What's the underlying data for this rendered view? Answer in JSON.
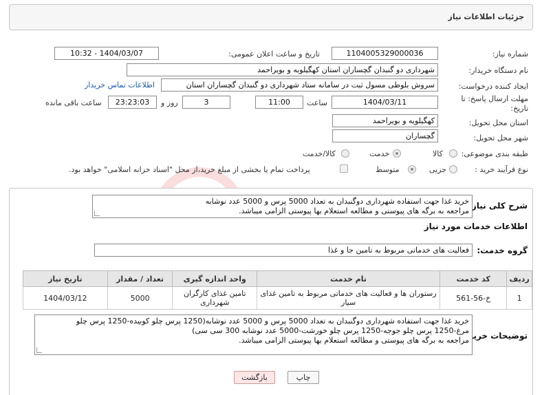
{
  "header": {
    "title": "جزئیات اطلاعات نیاز"
  },
  "form": {
    "need_number_label": "شماره نیاز:",
    "need_number": "1104005329000036",
    "announce_label": "تاریخ و ساعت اعلان عمومی:",
    "announce_value": "1404/03/07 - 10:32",
    "buyer_org_label": "نام دستگاه خریدار:",
    "buyer_org": "شهرداری دو گنبدان گچساران استان کهگیلویه و بویراحمد",
    "creator_label": "ایجاد کننده درخواست:",
    "creator": "سروش بلوطی مسول ثبت در سامانه ستاد شهرداری دو گنبدان گچساران استان",
    "contact_link": "اطلاعات تماس خریدار",
    "deadline_label_1": "مهلت ارسال پاسخ: تا",
    "deadline_label_2": "تاریخ:",
    "deadline_date": "1404/03/11",
    "time_label": "ساعت",
    "deadline_time": "11:00",
    "days": "3",
    "days_label": "روز و",
    "remaining": "23:23:03",
    "remaining_label": "ساعت باقی مانده",
    "province_label": "استان محل تحویل:",
    "province": "کهگیلویه و بویراحمد",
    "city_label": "شهر محل تحویل:",
    "city": "گچساران",
    "category_label": "طبقه بندی موضوعی:",
    "category_options": [
      "کالا",
      "خدمت",
      "کالا/خدمت"
    ],
    "category_selected": "خدمت",
    "process_label": "نوع فرآیند خرید :",
    "process_options": [
      "جزیی",
      "متوسط"
    ],
    "process_selected": "متوسط",
    "payment_note": "پرداخت تمام یا بخشی از مبلغ خرید،از محل \"اسناد خزانه اسلامی\" خواهد بود."
  },
  "description": {
    "label": "شرح کلی نیاز:",
    "line1": "خرید غذا جهت استفاده شهرداری دوگنبدان به تعداد 5000 پرس و 5000 عدد نوشابه",
    "line2": "مراجعه به برگه های پیوستی و مطالعه استعلام بها پیوستی الزامی میباشد."
  },
  "services": {
    "heading": "اطلاعات خدمات مورد نیاز",
    "group_label": "گروه خدمت:",
    "group_value": "فعالیت های خدماتی مربوط به تامین جا و غذا",
    "table_headers": [
      "ردیف",
      "کد خدمت",
      "نام خدمت",
      "واحد اندازه گیری",
      "تعداد / مقدار",
      "تاریخ نیاز"
    ],
    "rows": [
      {
        "row": "1",
        "code": "خ-56-561",
        "name": "رستوران ها و فعالیت های خدماتی مربوط به تامین غذای سیار",
        "unit_1": "تامین غذای کارگران",
        "unit_2": "شهرداری",
        "qty": "5000",
        "date": "1404/03/12"
      }
    ]
  },
  "buyer_notes": {
    "label": "توضیحات خریدار:",
    "line1": "خرید غذا جهت استفاده شهرداری دوگنبدان به تعداد 5000 پرس و 5000 عدد نوشابه(1250 پرس چلو کوبیده-1250 پرس چلو",
    "line2": "مرغ-1250 پرس چلو جوجه-1250 پرس چلو خورشت-5000 عدد نوشابه 300 سی سی)",
    "line3": "مراجعه به برگه های پیوستی و مطالعه استعلام بها پیوستی الزامی میباشد."
  },
  "buttons": {
    "print": "چاپ",
    "back": "بازگشت"
  },
  "watermark": {
    "text": "AriaTender.neT"
  }
}
